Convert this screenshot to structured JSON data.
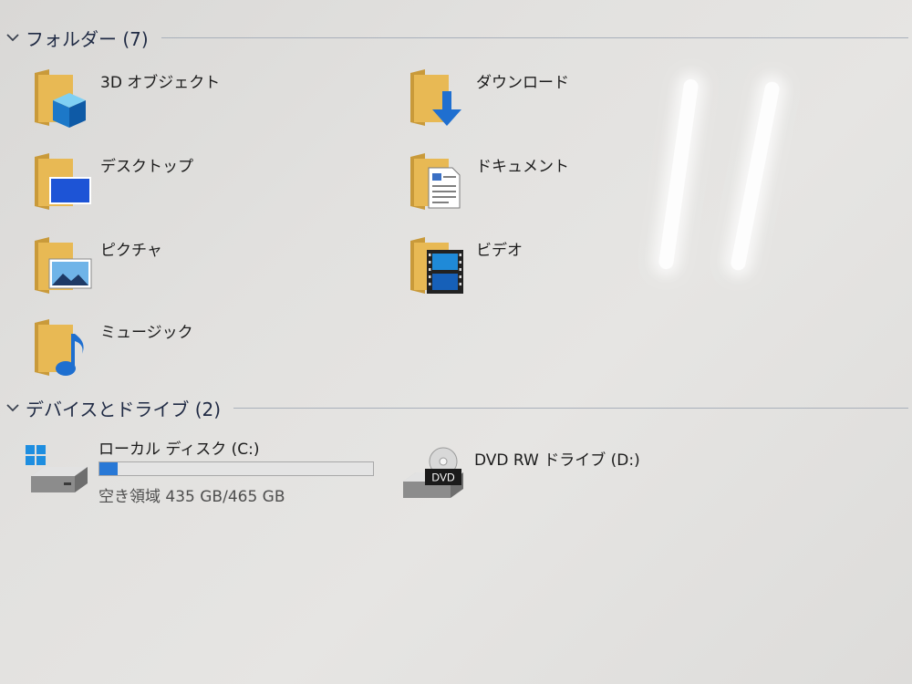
{
  "groups": {
    "folders": {
      "title": "フォルダー (7)"
    },
    "devices": {
      "title": "デバイスとドライブ (2)"
    }
  },
  "folders": [
    {
      "label": "3D オブジェクト",
      "icon": "3d-objects-icon"
    },
    {
      "label": "ダウンロード",
      "icon": "download-arrow-icon"
    },
    {
      "label": "デスクトップ",
      "icon": "desktop-monitor-icon"
    },
    {
      "label": "ドキュメント",
      "icon": "document-icon"
    },
    {
      "label": "ピクチャ",
      "icon": "picture-icon"
    },
    {
      "label": "ビデオ",
      "icon": "film-strip-icon"
    },
    {
      "label": "ミュージック",
      "icon": "music-note-icon"
    }
  ],
  "drives": [
    {
      "label": "ローカル ディスク (C:)",
      "free_text": "空き領域 435 GB/465 GB",
      "used_fraction": 0.065,
      "icon": "hard-drive-windows-icon"
    },
    {
      "label": "DVD RW ドライブ (D:)",
      "badge": "DVD",
      "icon": "dvd-drive-icon"
    }
  ],
  "colors": {
    "folder": "#e8b954",
    "folder_dark": "#c99a3a",
    "accent": "#2878d6",
    "windows_logo": "#1e8ee0"
  }
}
